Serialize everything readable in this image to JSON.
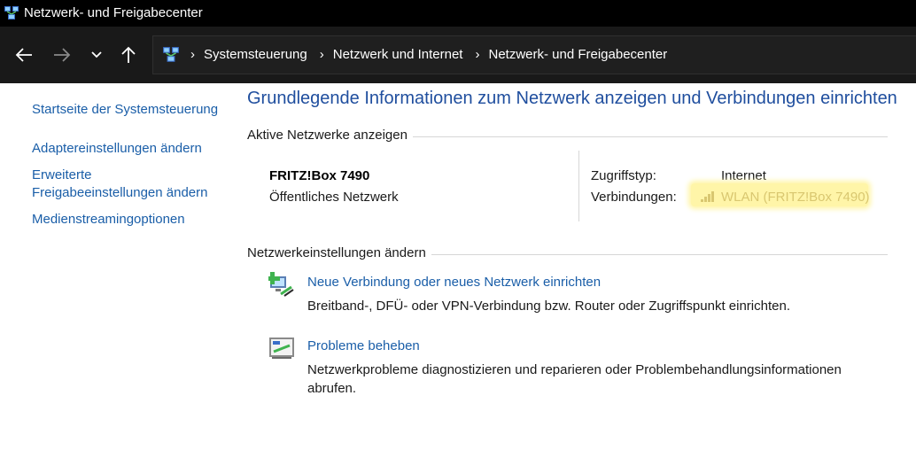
{
  "window": {
    "title": "Netzwerk- und Freigabecenter"
  },
  "breadcrumb": {
    "items": [
      "Systemsteuerung",
      "Netzwerk und Internet",
      "Netzwerk- und Freigabecenter"
    ]
  },
  "sidebar": {
    "items": [
      {
        "label": "Startseite der Systemsteuerung"
      },
      {
        "label": "Adaptereinstellungen ändern"
      },
      {
        "label": "Erweiterte"
      },
      {
        "label": "Freigabeeinstellungen ändern"
      },
      {
        "label": "Medienstreamingoptionen"
      }
    ]
  },
  "main": {
    "heading": "Grundlegende Informationen zum Netzwerk anzeigen und Verbindungen einrichten",
    "active_networks": {
      "section_label": "Aktive Netzwerke anzeigen",
      "network_name": "FRITZ!Box 7490",
      "network_type": "Öffentliches Netzwerk",
      "access_type_label": "Zugriffstyp:",
      "access_type_value": "Internet",
      "connections_label": "Verbindungen:",
      "connections_value": "WLAN (FRITZ!Box 7490)"
    },
    "change_settings": {
      "section_label": "Netzwerkeinstellungen ändern",
      "tasks": [
        {
          "link": "Neue Verbindung oder neues Netzwerk einrichten",
          "description": "Breitband-, DFÜ- oder VPN-Verbindung bzw. Router oder Zugriffspunkt einrichten."
        },
        {
          "link": "Probleme beheben",
          "description": "Netzwerkprobleme diagnostizieren und reparieren oder Problembehandlungsinformationen abrufen."
        }
      ]
    }
  },
  "icons": {
    "app": "network-center-icon",
    "back": "arrow-left-icon",
    "forward": "arrow-right-icon",
    "recent": "chevron-down-icon",
    "up": "arrow-up-icon",
    "address": "network-center-icon",
    "wlan": "wifi-signal-icon",
    "new_connection": "new-connection-icon",
    "troubleshoot": "troubleshoot-icon"
  },
  "colors": {
    "link": "#1a5ea8",
    "heading": "#1f4e9e",
    "highlight": "#fff5a8",
    "titlebar": "#000000",
    "navbar": "#191919"
  }
}
